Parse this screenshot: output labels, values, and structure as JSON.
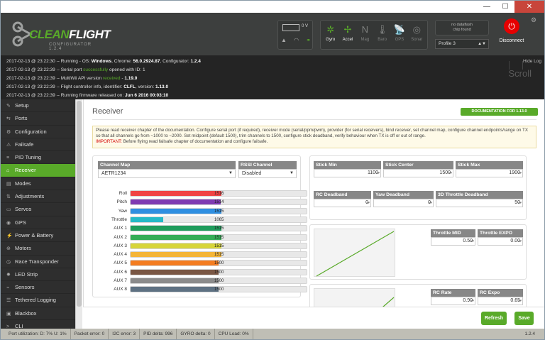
{
  "window": {
    "minimize": "—",
    "maximize": "☐",
    "close": "✕"
  },
  "logo": {
    "text_a": "CLEAN",
    "text_b": "FLIGHT",
    "sub": "CONFIGURATOR 1.2.4"
  },
  "battery": {
    "voltage": "0 V"
  },
  "sensors": [
    {
      "label": "Gyro",
      "icon": "✲",
      "active": true
    },
    {
      "label": "Accel",
      "icon": "✢",
      "active": true
    },
    {
      "label": "Mag",
      "icon": "N",
      "active": false
    },
    {
      "label": "Baro",
      "icon": "🌡",
      "active": false
    },
    {
      "label": "GPS",
      "icon": "📡",
      "active": false
    },
    {
      "label": "Sonar",
      "icon": "◎",
      "active": false
    }
  ],
  "dataflash": {
    "line1": "no dataflash",
    "line2": "chip found"
  },
  "profile": {
    "selected": "Profile 3"
  },
  "connect": {
    "label": "Disconnect",
    "icon": "plug-icon"
  },
  "log": {
    "hide_label": "Hide Log",
    "scroll_label": "Scroll",
    "lines": [
      {
        "pre": "2017-02-13 @ 23:22:30 -- Running - OS: ",
        "b1": "Windows",
        "mid": ", Chrome: ",
        "b2": "56.0.2924.87",
        "mid2": ", Configurator: ",
        "b3": "1.2.4"
      },
      {
        "pre": "2017-02-13 @ 23:22:39 -- Serial port ",
        "ok": "successfully",
        "post": " opened with ID: 1"
      },
      {
        "pre": "2017-02-13 @ 23:22:39 -- MultiWii API version ",
        "ok": "received",
        "post": " - ",
        "b1": "1.19.0"
      },
      {
        "pre": "2017-02-13 @ 23:22:39 -- Flight controller info, identifier: ",
        "b1": "CLFL",
        "mid": ", version: ",
        "b2": "1.13.0"
      },
      {
        "pre": "2017-02-13 @ 23:22:39 -- Running firmware released on: ",
        "b1": "Jun 6 2016 00:03:10"
      }
    ]
  },
  "sidebar": [
    {
      "label": "Setup",
      "icon": "wrench-icon",
      "glyph": "✎"
    },
    {
      "label": "Ports",
      "icon": "ports-icon",
      "glyph": "⇆"
    },
    {
      "label": "Configuration",
      "icon": "gear-icon",
      "glyph": "⚙"
    },
    {
      "label": "Failsafe",
      "icon": "failsafe-icon",
      "glyph": "⚠"
    },
    {
      "label": "PID Tuning",
      "icon": "pid-icon",
      "glyph": "≡"
    },
    {
      "label": "Receiver",
      "icon": "receiver-icon",
      "glyph": "⌂",
      "active": true
    },
    {
      "label": "Modes",
      "icon": "modes-icon",
      "glyph": "▤"
    },
    {
      "label": "Adjustments",
      "icon": "adjustments-icon",
      "glyph": "⇅"
    },
    {
      "label": "Servos",
      "icon": "servo-icon",
      "glyph": "▭"
    },
    {
      "label": "GPS",
      "icon": "gps-icon",
      "glyph": "◉"
    },
    {
      "label": "Power & Battery",
      "icon": "power-icon",
      "glyph": "⚡"
    },
    {
      "label": "Motors",
      "icon": "motor-icon",
      "glyph": "⊛"
    },
    {
      "label": "Race Transponder",
      "icon": "transponder-icon",
      "glyph": "◷"
    },
    {
      "label": "LED Strip",
      "icon": "led-icon",
      "glyph": "✹"
    },
    {
      "label": "Sensors",
      "icon": "sensors-icon",
      "glyph": "⌁"
    },
    {
      "label": "Tethered Logging",
      "icon": "logging-icon",
      "glyph": "☰"
    },
    {
      "label": "Blackbox",
      "icon": "blackbox-icon",
      "glyph": "▣"
    },
    {
      "label": "CLI",
      "icon": "cli-icon",
      "glyph": ">"
    }
  ],
  "receiver": {
    "title": "Receiver",
    "doc_button": "DOCUMENTATION FOR 1.13.0",
    "note": "Please read receiver chapter of the documentation. Configure serial port (if required), receiver mode (serial/ppm/pwm), provider (for serial receivers), bind receiver, set channel map, configure channel endpoints/range on TX so that all channels go from ~1000 to ~2000. Set midpoint (default 1500), trim channels to 1500, configure stick deadband, verify behaviour when TX is off or out of range.",
    "important_label": "IMPORTANT:",
    "important_text": " Before flying read failsafe chapter of documentation and configure failsafe.",
    "channel_map_label": "Channel Map",
    "channel_map_value": "AETR1234",
    "rssi_label": "RSSI Channel",
    "rssi_value": "Disabled",
    "stick_min_label": "Stick Min",
    "stick_min": "1100",
    "stick_center_label": "Stick Center",
    "stick_center": "1500",
    "stick_max_label": "Stick Max",
    "stick_max": "1900",
    "rc_deadband_label": "RC Deadband",
    "rc_deadband": "0",
    "yaw_deadband_label": "Yaw Deadband",
    "yaw_deadband": "0",
    "throttle_deadband_label": "3D Throttle Deadband",
    "throttle_deadband": "50",
    "throttle_mid_label": "Throttle MID",
    "throttle_mid": "0.50",
    "throttle_expo_label": "Throttle EXPO",
    "throttle_expo": "0.00",
    "rc_rate_label": "RC Rate",
    "rc_rate": "0.90",
    "rc_expo_label": "RC Expo",
    "rc_expo": "0.65",
    "refresh_button": "Refresh",
    "save_button": "Save"
  },
  "channels": [
    {
      "name": "Roll",
      "value": "1516",
      "fraction": 0.516,
      "color": "#f04343"
    },
    {
      "name": "Pitch",
      "value": "1514",
      "fraction": 0.514,
      "color": "#7f3ab2"
    },
    {
      "name": "Yaw",
      "value": "1515",
      "fraction": 0.515,
      "color": "#2f8fe1"
    },
    {
      "name": "Throttle",
      "value": "1065",
      "fraction": 0.185,
      "color": "#25b9c7"
    },
    {
      "name": "AUX 1",
      "value": "1515",
      "fraction": 0.515,
      "color": "#1e9c5c"
    },
    {
      "name": "AUX 2",
      "value": "1515",
      "fraction": 0.515,
      "color": "#35ad57"
    },
    {
      "name": "AUX 3",
      "value": "1515",
      "fraction": 0.515,
      "color": "#d7d53a"
    },
    {
      "name": "AUX 4",
      "value": "1515",
      "fraction": 0.515,
      "color": "#f4b538"
    },
    {
      "name": "AUX 5",
      "value": "1500",
      "fraction": 0.5,
      "color": "#f47c20"
    },
    {
      "name": "AUX 6",
      "value": "1500",
      "fraction": 0.5,
      "color": "#7a5744"
    },
    {
      "name": "AUX 7",
      "value": "1500",
      "fraction": 0.5,
      "color": "#8b8b8b"
    },
    {
      "name": "AUX 8",
      "value": "1500",
      "fraction": 0.5,
      "color": "#5e7182"
    }
  ],
  "statusbar": {
    "port_util": "Port utilization: D: 7% U: 1%",
    "packet_error": "Packet error: 0",
    "i2c_error": "I2C error: 3",
    "pid_delta": "PID delta: 996",
    "gyro_delta": "GYRO delta: 0",
    "cpu_load": "CPU Load: 0%",
    "version": "1.2.4"
  }
}
